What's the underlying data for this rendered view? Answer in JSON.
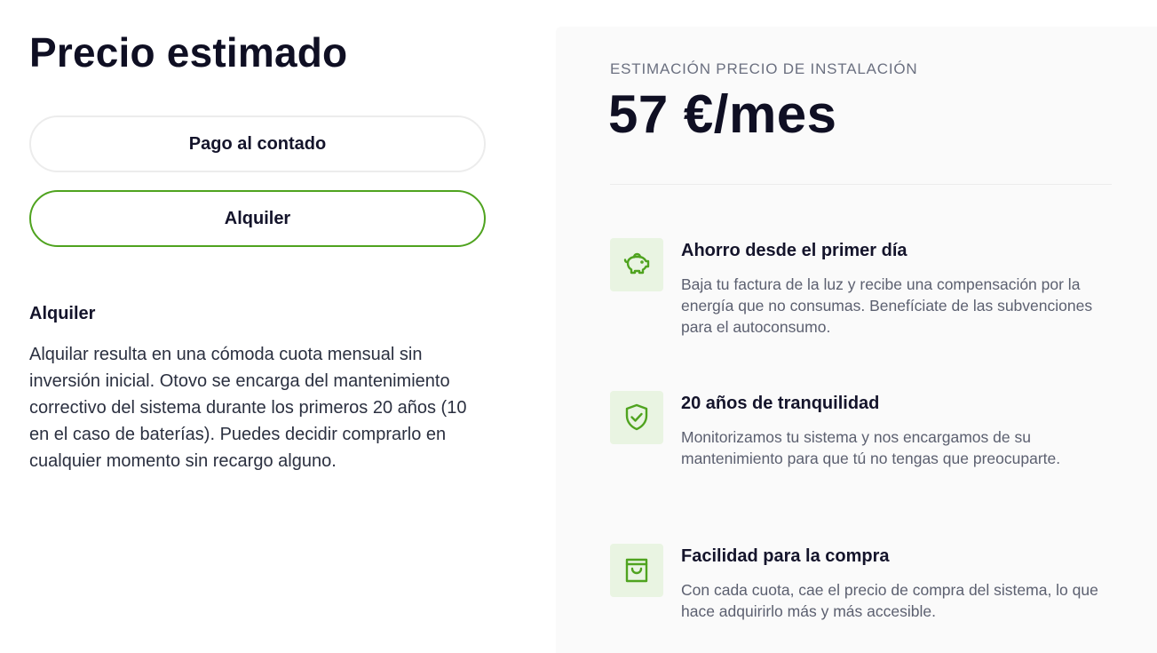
{
  "page_title": "Precio estimado",
  "payment_options": {
    "cash_label": "Pago al contado",
    "rent_label": "Alquiler",
    "selected": "Alquiler"
  },
  "details": {
    "title": "Alquiler",
    "body": "Alquilar resulta en una cómoda cuota mensual sin inversión inicial. Otovo se encarga del mantenimiento correctivo del sistema durante los primeros 20 años (10 en el caso de baterías). Puedes decidir comprarlo en cualquier momento sin recargo alguno."
  },
  "estimate": {
    "label": "ESTIMACIÓN PRECIO DE INSTALACIÓN",
    "price": "57 €/mes"
  },
  "features": [
    {
      "icon": "piggy-bank-icon",
      "title": "Ahorro desde el primer día",
      "description": "Baja tu factura de la luz y recibe una compensación por la energía que no consumas. Benefíciate de las subvenciones para el autoconsumo."
    },
    {
      "icon": "shield-check-icon",
      "title": "20 años de tranquilidad",
      "description": "Monitorizamos tu sistema y nos encargamos de su mantenimiento para que tú no tengas que preocuparte."
    },
    {
      "icon": "shopping-bag-icon",
      "title": "Facilidad para la compra",
      "description": "Con cada cuota, cae el precio de compra del sistema, lo que hace adquirirlo más y más accesible."
    }
  ],
  "colors": {
    "accent": "#4fa31f",
    "icon_bg": "#e9f4e2",
    "panel_bg": "#fafafa"
  }
}
